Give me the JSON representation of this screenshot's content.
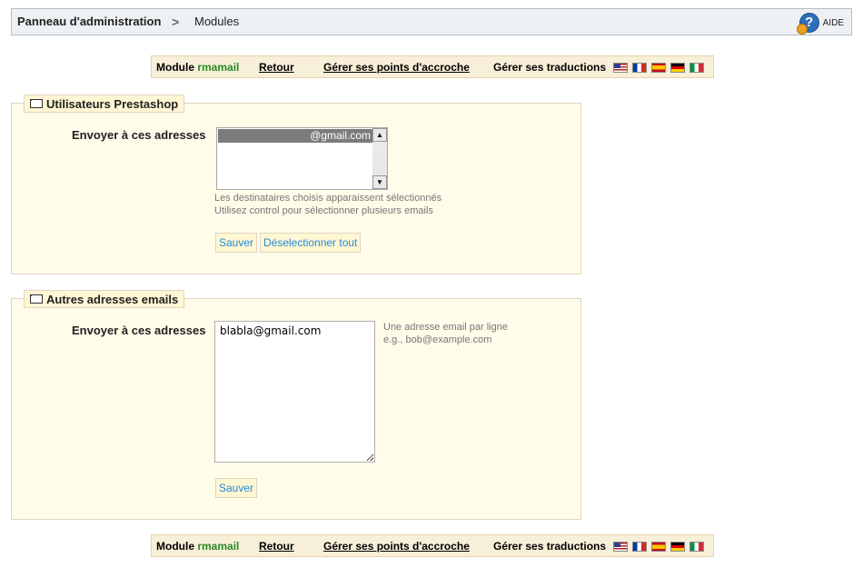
{
  "breadcrumb": {
    "home": "Panneau d'administration",
    "separator": ">",
    "current": "Modules"
  },
  "help": {
    "label": "AIDE",
    "icon": "help-icon"
  },
  "module_bar": {
    "module_prefix": "Module",
    "module_name": "rmamail",
    "back_link": "Retour",
    "hooks_link": "Gérer ses points d'accroche",
    "translations_label": "Gérer ses traductions",
    "flags": [
      "en",
      "fr",
      "es",
      "de",
      "it"
    ],
    "accent_color": "#268c26"
  },
  "prestashop_users": {
    "legend": "Utilisateurs Prestashop",
    "field_label": "Envoyer à ces adresses",
    "selected_option": "@gmail.com",
    "hint_line1": "Les destinataires choisis apparaissent sélectionnés",
    "hint_line2": "Utilisez control pour sélectionner plusieurs emails",
    "save_button": "Sauver",
    "deselect_button": "Déselectionner tout"
  },
  "other_emails": {
    "legend": "Autres adresses emails",
    "field_label": "Envoyer à ces adresses",
    "textarea_value": "blabla@gmail.com",
    "hint_line1": "Une adresse email par ligne",
    "hint_line2": "e.g., bob@example.com",
    "save_button": "Sauver"
  }
}
